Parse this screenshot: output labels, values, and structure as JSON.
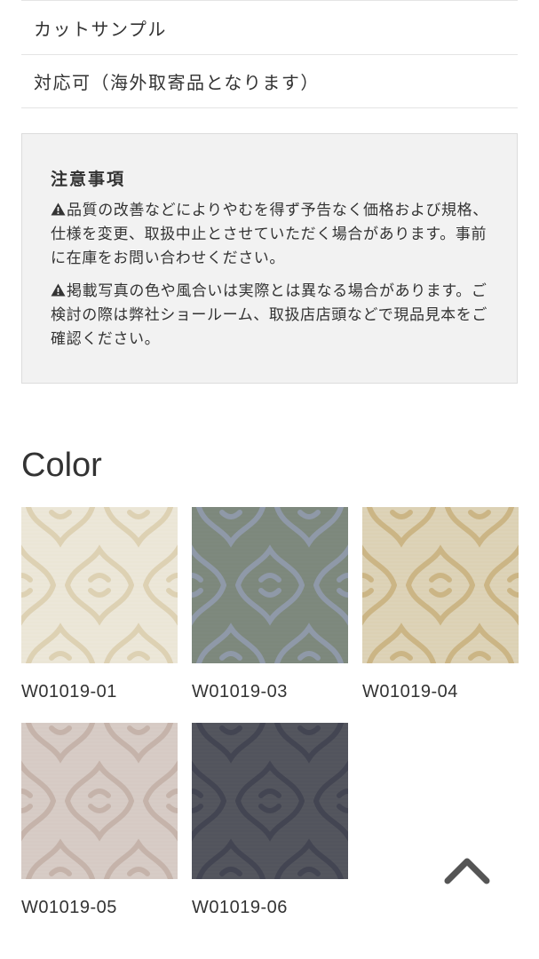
{
  "spec_rows": [
    {
      "label": "カットサンプル"
    },
    {
      "label": "対応可（海外取寄品となります）"
    }
  ],
  "notice": {
    "title": "注意事項",
    "paragraphs": [
      "品質の改善などによりやむを得ず予告なく価格および規格、仕様を変更、取扱中止とさせていただく場合があります。事前に在庫をお問い合わせください。",
      "掲載写真の色や風合いは実際とは異なる場合があります。ご検討の際は弊社ショールーム、取扱店店頭などで現品見本をご確認ください。"
    ],
    "icon": "warning-icon"
  },
  "color_section": {
    "title": "Color",
    "swatches": [
      {
        "code": "W01019-01",
        "base": "#ece7d9",
        "pattern": "#ddd1b3"
      },
      {
        "code": "W01019-03",
        "base": "#7d887c",
        "pattern": "#8f99a8"
      },
      {
        "code": "W01019-04",
        "base": "#ddd3b8",
        "pattern": "#cbb585"
      },
      {
        "code": "W01019-05",
        "base": "#d7ccc6",
        "pattern": "#c5b3aa"
      },
      {
        "code": "W01019-06",
        "base": "#54565e",
        "pattern": "#434552"
      }
    ]
  },
  "back_to_top": {
    "icon": "chevron-up-icon",
    "color": "#555555"
  }
}
